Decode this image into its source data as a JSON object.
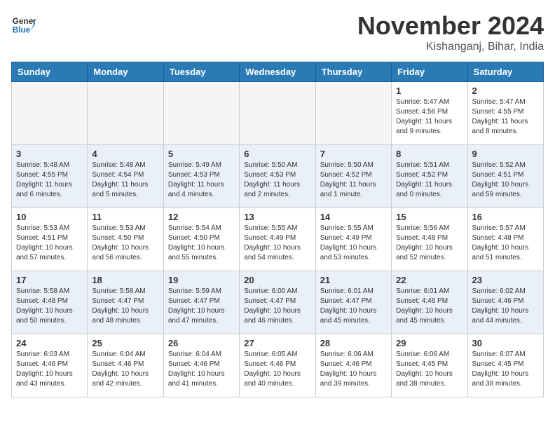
{
  "header": {
    "logo_general": "General",
    "logo_blue": "Blue",
    "month_title": "November 2024",
    "location": "Kishanganj, Bihar, India"
  },
  "weekdays": [
    "Sunday",
    "Monday",
    "Tuesday",
    "Wednesday",
    "Thursday",
    "Friday",
    "Saturday"
  ],
  "weeks": [
    [
      {
        "day": "",
        "empty": true
      },
      {
        "day": "",
        "empty": true
      },
      {
        "day": "",
        "empty": true
      },
      {
        "day": "",
        "empty": true
      },
      {
        "day": "",
        "empty": true
      },
      {
        "day": "1",
        "sunrise": "5:47 AM",
        "sunset": "4:56 PM",
        "daylight": "11 hours and 9 minutes."
      },
      {
        "day": "2",
        "sunrise": "5:47 AM",
        "sunset": "4:55 PM",
        "daylight": "11 hours and 8 minutes."
      }
    ],
    [
      {
        "day": "3",
        "sunrise": "5:48 AM",
        "sunset": "4:55 PM",
        "daylight": "11 hours and 6 minutes."
      },
      {
        "day": "4",
        "sunrise": "5:48 AM",
        "sunset": "4:54 PM",
        "daylight": "11 hours and 5 minutes."
      },
      {
        "day": "5",
        "sunrise": "5:49 AM",
        "sunset": "4:53 PM",
        "daylight": "11 hours and 4 minutes."
      },
      {
        "day": "6",
        "sunrise": "5:50 AM",
        "sunset": "4:53 PM",
        "daylight": "11 hours and 2 minutes."
      },
      {
        "day": "7",
        "sunrise": "5:50 AM",
        "sunset": "4:52 PM",
        "daylight": "11 hours and 1 minute."
      },
      {
        "day": "8",
        "sunrise": "5:51 AM",
        "sunset": "4:52 PM",
        "daylight": "11 hours and 0 minutes."
      },
      {
        "day": "9",
        "sunrise": "5:52 AM",
        "sunset": "4:51 PM",
        "daylight": "10 hours and 59 minutes."
      }
    ],
    [
      {
        "day": "10",
        "sunrise": "5:53 AM",
        "sunset": "4:51 PM",
        "daylight": "10 hours and 57 minutes."
      },
      {
        "day": "11",
        "sunrise": "5:53 AM",
        "sunset": "4:50 PM",
        "daylight": "10 hours and 56 minutes."
      },
      {
        "day": "12",
        "sunrise": "5:54 AM",
        "sunset": "4:50 PM",
        "daylight": "10 hours and 55 minutes."
      },
      {
        "day": "13",
        "sunrise": "5:55 AM",
        "sunset": "4:49 PM",
        "daylight": "10 hours and 54 minutes."
      },
      {
        "day": "14",
        "sunrise": "5:55 AM",
        "sunset": "4:49 PM",
        "daylight": "10 hours and 53 minutes."
      },
      {
        "day": "15",
        "sunrise": "5:56 AM",
        "sunset": "4:48 PM",
        "daylight": "10 hours and 52 minutes."
      },
      {
        "day": "16",
        "sunrise": "5:57 AM",
        "sunset": "4:48 PM",
        "daylight": "10 hours and 51 minutes."
      }
    ],
    [
      {
        "day": "17",
        "sunrise": "5:58 AM",
        "sunset": "4:48 PM",
        "daylight": "10 hours and 50 minutes."
      },
      {
        "day": "18",
        "sunrise": "5:58 AM",
        "sunset": "4:47 PM",
        "daylight": "10 hours and 48 minutes."
      },
      {
        "day": "19",
        "sunrise": "5:59 AM",
        "sunset": "4:47 PM",
        "daylight": "10 hours and 47 minutes."
      },
      {
        "day": "20",
        "sunrise": "6:00 AM",
        "sunset": "4:47 PM",
        "daylight": "10 hours and 46 minutes."
      },
      {
        "day": "21",
        "sunrise": "6:01 AM",
        "sunset": "4:47 PM",
        "daylight": "10 hours and 45 minutes."
      },
      {
        "day": "22",
        "sunrise": "6:01 AM",
        "sunset": "4:46 PM",
        "daylight": "10 hours and 45 minutes."
      },
      {
        "day": "23",
        "sunrise": "6:02 AM",
        "sunset": "4:46 PM",
        "daylight": "10 hours and 44 minutes."
      }
    ],
    [
      {
        "day": "24",
        "sunrise": "6:03 AM",
        "sunset": "4:46 PM",
        "daylight": "10 hours and 43 minutes."
      },
      {
        "day": "25",
        "sunrise": "6:04 AM",
        "sunset": "4:46 PM",
        "daylight": "10 hours and 42 minutes."
      },
      {
        "day": "26",
        "sunrise": "6:04 AM",
        "sunset": "4:46 PM",
        "daylight": "10 hours and 41 minutes."
      },
      {
        "day": "27",
        "sunrise": "6:05 AM",
        "sunset": "4:46 PM",
        "daylight": "10 hours and 40 minutes."
      },
      {
        "day": "28",
        "sunrise": "6:06 AM",
        "sunset": "4:46 PM",
        "daylight": "10 hours and 39 minutes."
      },
      {
        "day": "29",
        "sunrise": "6:06 AM",
        "sunset": "4:45 PM",
        "daylight": "10 hours and 38 minutes."
      },
      {
        "day": "30",
        "sunrise": "6:07 AM",
        "sunset": "4:45 PM",
        "daylight": "10 hours and 38 minutes."
      }
    ]
  ],
  "labels": {
    "sunrise": "Sunrise:",
    "sunset": "Sunset:",
    "daylight": "Daylight:"
  }
}
